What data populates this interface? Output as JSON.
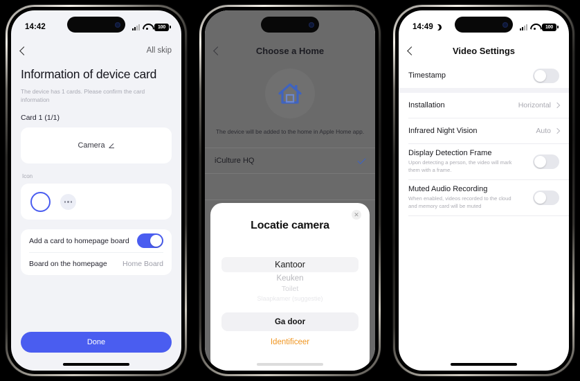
{
  "phone1": {
    "status": {
      "time": "14:42",
      "battery": "100"
    },
    "nav": {
      "back_icon": "chevron-left-icon",
      "right_action": "All skip"
    },
    "heading": "Information of device card",
    "subtext": "The device has 1 cards. Please confirm the card information",
    "card_label": "Card 1 (1/1)",
    "camera_name": "Camera",
    "icon_label": "Icon",
    "rows": [
      {
        "label": "Add a card to homepage board",
        "control": "toggle",
        "value": "on"
      },
      {
        "label": "Board on the homepage",
        "control": "value",
        "value": "Home Board"
      }
    ],
    "primary_button": "Done"
  },
  "phone2": {
    "status": {
      "time": "",
      "battery": ""
    },
    "nav": {
      "back_icon": "chevron-left-icon",
      "title": "Choose a Home"
    },
    "illustration": "house-icon",
    "note": "The device will be added to the home in Apple Home app.",
    "home_list": [
      {
        "label": "iCulture HQ",
        "selected": true
      }
    ],
    "sheet": {
      "close_icon": "close-icon",
      "title": "Locatie camera",
      "picker": {
        "selected": "Kantoor",
        "options": [
          "Kantoor",
          "Keuken",
          "Toilet",
          "Slaapkamer (suggestie)"
        ]
      },
      "continue_button": "Ga door",
      "link": "Identificeer"
    }
  },
  "phone3": {
    "status": {
      "time": "14:49",
      "battery": "100",
      "moon_icon": "moon-icon"
    },
    "nav": {
      "back_icon": "chevron-left-icon",
      "title": "Video Settings"
    },
    "rows": [
      {
        "label": "Timestamp",
        "sub": "",
        "control": "toggle",
        "value": "off"
      },
      {
        "label": "Installation",
        "sub": "",
        "control": "value",
        "value": "Horizontal"
      },
      {
        "label": "Infrared Night Vision",
        "sub": "",
        "control": "value",
        "value": "Auto"
      },
      {
        "label": "Display Detection Frame",
        "sub": "Upon detecting a person, the video will mark them with a frame.",
        "control": "toggle",
        "value": "off"
      },
      {
        "label": "Muted Audio Recording",
        "sub": "When enabled, videos recorded to the cloud and memory card will be muted",
        "control": "toggle",
        "value": "off"
      }
    ]
  },
  "colors": {
    "accent_blue": "#4a5df0",
    "link_orange": "#f0951f",
    "check_blue": "#3b63c8",
    "background": "#000000"
  }
}
